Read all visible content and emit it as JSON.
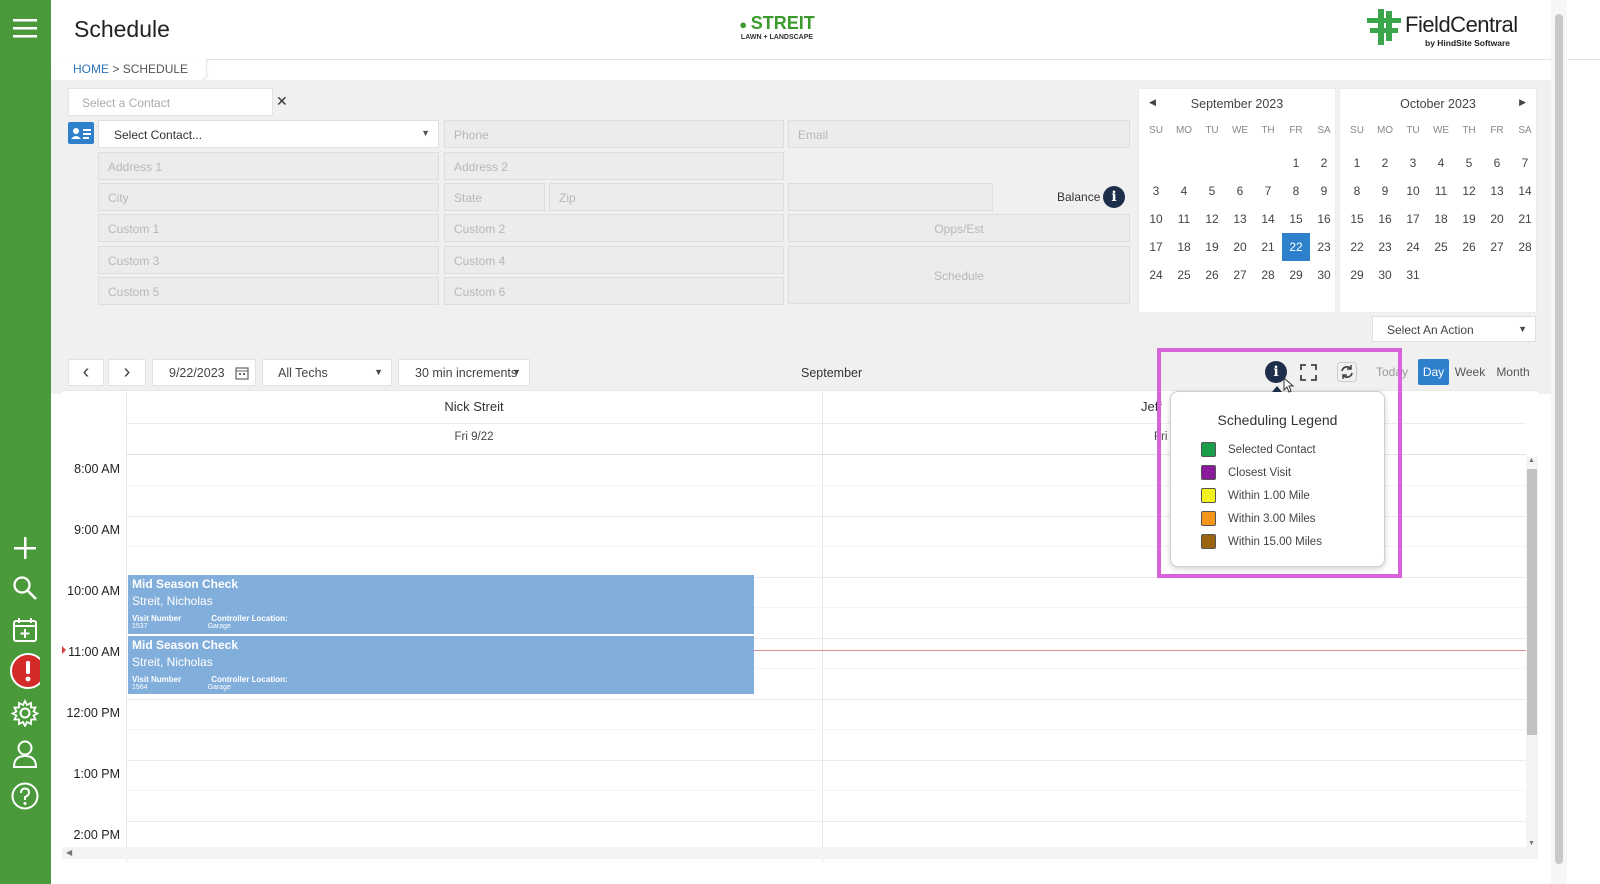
{
  "header": {
    "title": "Schedule",
    "logo_center_main": "STREIT",
    "logo_center_sub": "LAWN + LANDSCAPE",
    "logo_right_main": "FieldCentral",
    "logo_right_sub": "by HindSite Software"
  },
  "breadcrumb": {
    "home": "HOME",
    "sep": " > ",
    "current": "SCHEDULE"
  },
  "sidebar": {
    "icons": [
      "menu-icon",
      "plus-icon",
      "search-icon",
      "calendar-add-icon",
      "alert-icon",
      "gear-icon",
      "user-icon",
      "help-icon"
    ]
  },
  "contact": {
    "select_placeholder": "Select a Contact",
    "contact_dropdown": "Select Contact...",
    "phone": "Phone",
    "email": "Email",
    "address1": "Address 1",
    "address2": "Address 2",
    "city": "City",
    "state": "State",
    "zip": "Zip",
    "custom1": "Custom 1",
    "custom2": "Custom 2",
    "custom3": "Custom 3",
    "custom4": "Custom 4",
    "custom5": "Custom 5",
    "custom6": "Custom 6",
    "balance_label": "Balance",
    "opps_button": "Opps/Est",
    "schedule_button": "Schedule"
  },
  "calendars": [
    {
      "title": "September 2023",
      "lead_blanks": 5,
      "days": [
        "1",
        "2",
        "3",
        "4",
        "5",
        "6",
        "7",
        "8",
        "9",
        "10",
        "11",
        "12",
        "13",
        "14",
        "15",
        "16",
        "17",
        "18",
        "19",
        "20",
        "21",
        "22",
        "23",
        "24",
        "25",
        "26",
        "27",
        "28",
        "29",
        "30"
      ],
      "selected": "22"
    },
    {
      "title": "October 2023",
      "lead_blanks": 0,
      "days": [
        "1",
        "2",
        "3",
        "4",
        "5",
        "6",
        "7",
        "8",
        "9",
        "10",
        "11",
        "12",
        "13",
        "14",
        "15",
        "16",
        "17",
        "18",
        "19",
        "20",
        "21",
        "22",
        "23",
        "24",
        "25",
        "26",
        "27",
        "28",
        "29",
        "30",
        "31"
      ],
      "selected": ""
    }
  ],
  "dow": [
    "SU",
    "MO",
    "TU",
    "WE",
    "TH",
    "FR",
    "SA"
  ],
  "action_select": "Select An Action",
  "toolbar": {
    "date": "9/22/2023",
    "techs": "All Techs",
    "increments": "30 min increments",
    "month_label": "September",
    "today": "Today",
    "day": "Day",
    "week": "Week",
    "month": "Month"
  },
  "columns": [
    {
      "name": "Nick Streit",
      "date": "Fri 9/22"
    },
    {
      "name": "Jeff",
      "date": "Fri"
    }
  ],
  "time_labels": [
    "8:00 AM",
    "9:00 AM",
    "10:00 AM",
    "11:00 AM",
    "12:00 PM",
    "1:00 PM",
    "2:00 PM"
  ],
  "events": [
    {
      "title": "Mid Season Check",
      "name": "Streit, Nicholas",
      "f1": "Visit Number",
      "f2": "Controller Location:",
      "v1": "1537",
      "v2": "Garage"
    },
    {
      "title": "Mid Season Check",
      "name": "Streit, Nicholas",
      "f1": "Visit Number",
      "f2": "Controller Location:",
      "v1": "1564",
      "v2": "Garage"
    }
  ],
  "legend": {
    "title": "Scheduling Legend",
    "items": [
      {
        "label": "Selected Contact",
        "color": "#1a9e4a"
      },
      {
        "label": "Closest Visit",
        "color": "#8a1a9c"
      },
      {
        "label": "Within 1.00 Mile",
        "color": "#f4f21c"
      },
      {
        "label": "Within 3.00 Miles",
        "color": "#f5951a"
      },
      {
        "label": "Within 15.00 Miles",
        "color": "#9a6410"
      }
    ]
  },
  "colors": {
    "sidebar": "#4a9a3c",
    "accent": "#2e7fcc",
    "event": "#82aedc",
    "highlight": "#d764d8"
  }
}
